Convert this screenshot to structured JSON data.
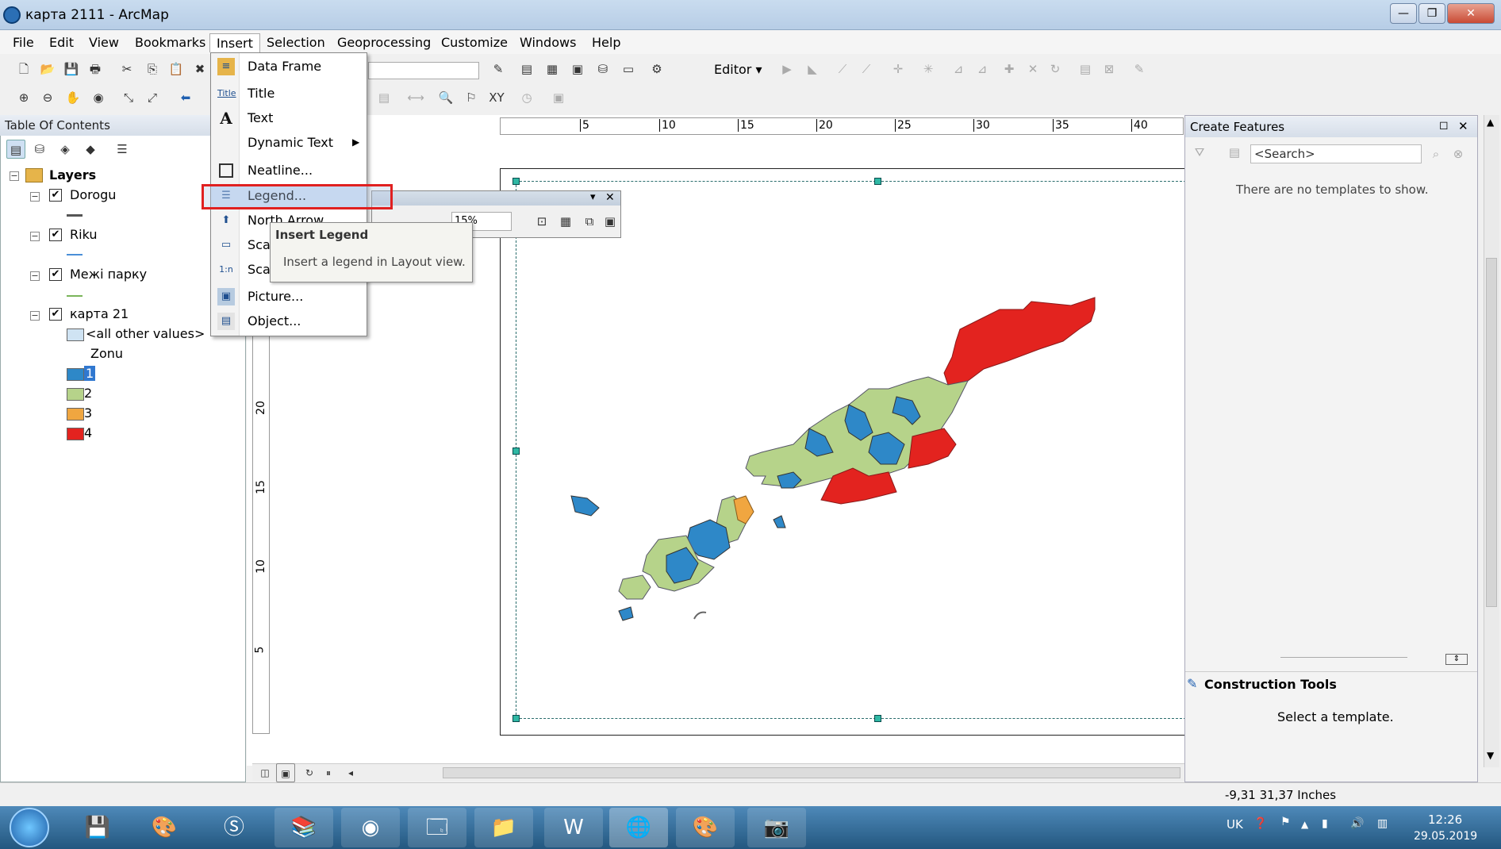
{
  "window": {
    "title": "карта 2111 - ArcMap",
    "minimize": "—",
    "maximize": "❐",
    "close": "✕"
  },
  "menubar": [
    "File",
    "Edit",
    "View",
    "Bookmarks",
    "Insert",
    "Selection",
    "Geoprocessing",
    "Customize",
    "Windows",
    "Help"
  ],
  "toolbar": {
    "editor_label": "Editor ▾"
  },
  "toc": {
    "title": "Table Of Contents",
    "layers_label": "Layers",
    "items": [
      {
        "label": "Dorogu",
        "checked": "✔"
      },
      {
        "label": "Riku",
        "checked": "✔"
      },
      {
        "label": "Межі парку",
        "checked": "✔"
      },
      {
        "label": "карта 21",
        "checked": "✔"
      }
    ],
    "other_values": "<all other values>",
    "field": "Zonu",
    "classes": [
      {
        "label": "1",
        "color": "#2e88c8"
      },
      {
        "label": "2",
        "color": "#b6d38a"
      },
      {
        "label": "3",
        "color": "#f0a640"
      },
      {
        "label": "4",
        "color": "#e3231f"
      }
    ]
  },
  "insert_menu": [
    {
      "label": "Data Frame",
      "icon": "data-frame-icon"
    },
    {
      "label": "Title",
      "icon": "title-icon"
    },
    {
      "label": "Text",
      "icon": "text-icon"
    },
    {
      "label": "Dynamic Text",
      "icon": "dynamic-text-icon"
    },
    {
      "label": "Neatline...",
      "icon": "neatline-icon"
    },
    {
      "label": "Legend...",
      "icon": "legend-icon"
    },
    {
      "label": "North Arrow...",
      "icon": "north-arrow-icon"
    },
    {
      "label": "Scale Bar...",
      "icon": "scale-bar-icon"
    },
    {
      "label": "Scale Text...",
      "icon": "scale-text-icon"
    },
    {
      "label": "Picture...",
      "icon": "picture-icon"
    },
    {
      "label": "Object...",
      "icon": "object-icon"
    }
  ],
  "menu_visible": {
    "north": "North Arrow...",
    "scale_bar": "Scale Bar...",
    "scale_text": "Scale Text..."
  },
  "tooltip": {
    "title": "Insert Legend",
    "text": "Insert a legend in Layout view."
  },
  "float_toolbar": {
    "zoom": "15%"
  },
  "ruler_h": [
    "5",
    "10",
    "15",
    "20",
    "25",
    "30",
    "35",
    "40"
  ],
  "ruler_v": [
    "20",
    "15",
    "10",
    "5"
  ],
  "create_features": {
    "title": "Create Features",
    "search_placeholder": "<Search>",
    "empty": "There are no templates to show.",
    "construction_title": "Construction Tools",
    "construction_text": "Select a template."
  },
  "status": {
    "coords": "-9,31  31,37 Inches"
  },
  "taskbar": {
    "lang": "UK",
    "time": "12:26",
    "date": "29.05.2019"
  },
  "colors": {
    "zone1": "#2e88c8",
    "zone2": "#b6d38a",
    "zone3": "#f0a640",
    "zone4": "#e3231f",
    "highlight": "#e02020"
  }
}
